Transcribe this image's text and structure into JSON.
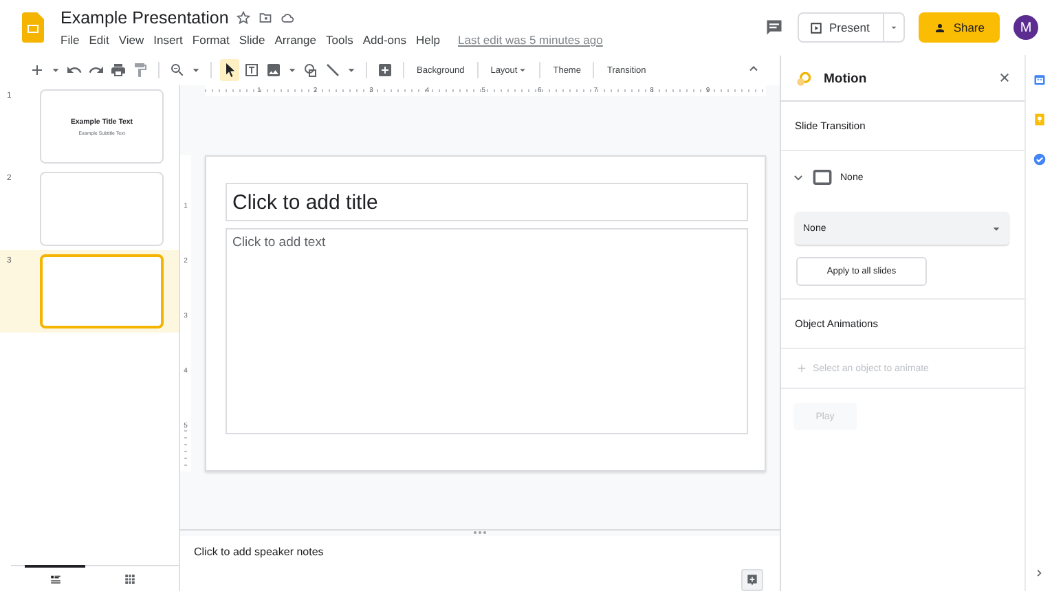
{
  "document": {
    "title": "Example Presentation",
    "starred": false,
    "menu": [
      "File",
      "Edit",
      "View",
      "Insert",
      "Format",
      "Slide",
      "Arrange",
      "Tools",
      "Add-ons",
      "Help"
    ],
    "last_edit": "Last edit was 5 minutes ago"
  },
  "present": {
    "label": "Present"
  },
  "share": {
    "label": "Share"
  },
  "account": {
    "initial": "M"
  },
  "toolbar": {
    "tool_groups": [
      [
        {
          "kind": "new",
          "selected": false
        },
        {
          "kind": "caret",
          "selected": false
        },
        {
          "kind": "undo",
          "selected": false
        },
        {
          "kind": "redo",
          "selected": false
        },
        {
          "kind": "print",
          "selected": false
        },
        {
          "kind": "paint-format",
          "selected": false
        }
      ],
      [
        {
          "kind": "zoom",
          "selected": false
        },
        {
          "kind": "caret",
          "selected": false
        }
      ],
      [
        {
          "kind": "select",
          "selected": true
        },
        {
          "kind": "textbox",
          "selected": false
        },
        {
          "kind": "image",
          "selected": false
        },
        {
          "kind": "caret",
          "selected": false
        },
        {
          "kind": "shape",
          "selected": false
        },
        {
          "kind": "line",
          "selected": false
        },
        {
          "kind": "caret",
          "selected": false
        }
      ],
      [
        {
          "kind": "comment",
          "selected": false
        }
      ]
    ],
    "actions": [
      {
        "label": "Background",
        "menu": false
      },
      {
        "label": "Layout",
        "menu": true
      },
      {
        "label": "Theme",
        "menu": false
      },
      {
        "label": "Transition",
        "menu": false
      }
    ]
  },
  "slides": [
    {
      "number": "1",
      "title": "Example Title Text",
      "subtitle": "Example Subtitle Text",
      "selected": false
    },
    {
      "number": "2",
      "selected": false
    },
    {
      "number": "3",
      "selected": true
    }
  ],
  "view_tabs": [
    {
      "kind": "filmstrip",
      "selected": true
    },
    {
      "kind": "grid",
      "selected": false
    }
  ],
  "ruler": {
    "horizontal": [
      "1",
      "2",
      "3",
      "4",
      "5",
      "6",
      "7",
      "8",
      "9"
    ],
    "vertical": [
      "1",
      "2",
      "3",
      "4",
      "5"
    ]
  },
  "slide": {
    "title_placeholder": "Click to add title",
    "body_placeholder": "Click to add text"
  },
  "speaker_notes": {
    "placeholder": "Click to add speaker notes"
  },
  "motion_panel": {
    "title": "Motion",
    "slide_transition": {
      "heading": "Slide Transition",
      "expanded": true,
      "current": "None",
      "dropdown": {
        "value": "None"
      },
      "apply_button": "Apply to all slides"
    },
    "object_animations": {
      "heading": "Object Animations",
      "add": {
        "label": "Select an object to animate",
        "disabled": true
      },
      "play": {
        "label": "Play",
        "disabled": true
      }
    }
  }
}
